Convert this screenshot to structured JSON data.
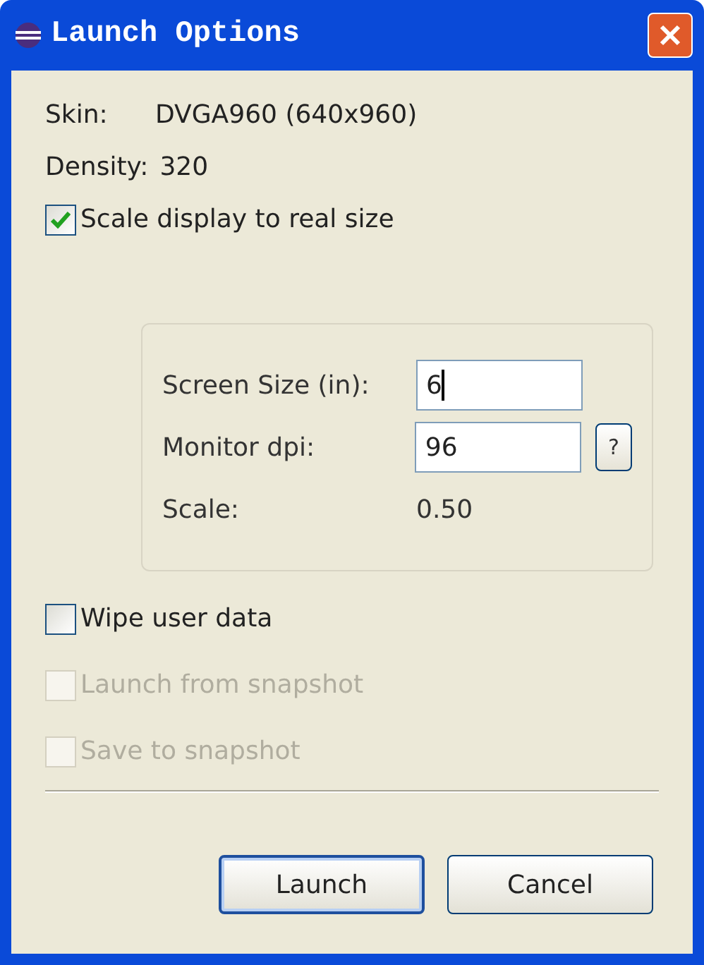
{
  "window": {
    "title": "Launch Options"
  },
  "info": [
    {
      "label": "Skin:",
      "value": "DVGA960 (640x960)"
    },
    {
      "label": "Density:",
      "value": "320"
    }
  ],
  "scale_checkbox": {
    "label": "Scale display to real size",
    "checked": true,
    "disabled": false
  },
  "scale_group": {
    "rows": [
      {
        "kind": "field",
        "label": "Screen Size (in):",
        "value": "6",
        "focused": true
      },
      {
        "kind": "field",
        "label": "Monitor dpi:",
        "value": "96",
        "focused": false,
        "help": "?"
      },
      {
        "kind": "readout",
        "label": "Scale:",
        "value": "0.50"
      }
    ]
  },
  "options": [
    {
      "label": "Wipe user data",
      "checked": false,
      "disabled": false
    },
    {
      "label": "Launch from snapshot",
      "checked": false,
      "disabled": true
    },
    {
      "label": "Save to snapshot",
      "checked": false,
      "disabled": true
    }
  ],
  "buttons": [
    {
      "label": "Launch",
      "default": true
    },
    {
      "label": "Cancel",
      "default": false
    }
  ]
}
